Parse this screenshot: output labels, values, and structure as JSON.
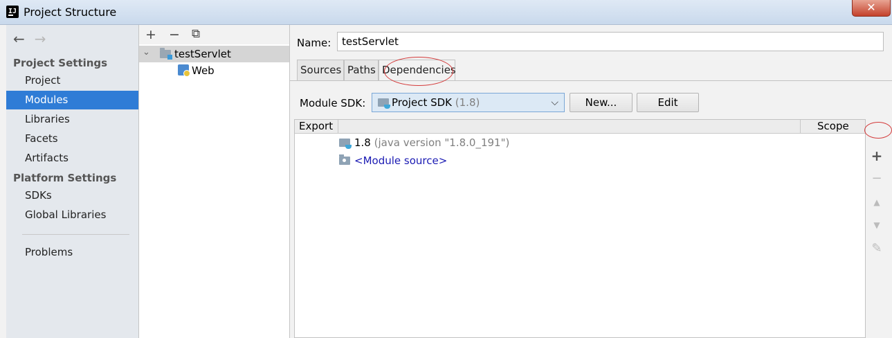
{
  "window": {
    "title": "Project Structure",
    "close_glyph": "✕",
    "app_icon_label": "IJ"
  },
  "nav": {
    "back_glyph": "←",
    "forward_glyph": "→",
    "project_settings_header": "Project Settings",
    "platform_settings_header": "Platform Settings",
    "items": {
      "project": "Project",
      "modules": "Modules",
      "libraries": "Libraries",
      "facets": "Facets",
      "artifacts": "Artifacts",
      "sdks": "SDKs",
      "global_libraries": "Global Libraries",
      "problems": "Problems"
    },
    "active_item": "Modules"
  },
  "tree": {
    "add_glyph": "+",
    "remove_glyph": "−",
    "copy_glyph": "⧉",
    "expand_glyph": "⌄",
    "module_name": "testServlet",
    "child_name": "Web"
  },
  "main": {
    "name_label": "Name:",
    "name_value": "testServlet",
    "tabs": {
      "sources": "Sources",
      "paths": "Paths",
      "dependencies": "Dependencies"
    },
    "active_tab": "Dependencies",
    "module_sdk_label": "Module SDK:",
    "sdk_selected": "Project SDK",
    "sdk_version": "(1.8)",
    "sdk_chevron": "⌵",
    "new_button": "New...",
    "edit_button": "Edit",
    "table": {
      "col_export": "Export",
      "col_scope": "Scope",
      "rows": [
        {
          "name": "1.8",
          "detail": "(java version \"1.8.0_191\")"
        },
        {
          "name": "<Module source>"
        }
      ]
    },
    "side_tools": {
      "add": "+",
      "remove": "−",
      "up": "▲",
      "down": "▼",
      "edit": "✎"
    }
  },
  "colors": {
    "selection_blue": "#2f7cd6",
    "annotation_red": "#d43a3a",
    "link_blue": "#1a1ab3"
  },
  "icons": [
    "app-icon",
    "back-arrow-icon",
    "forward-arrow-icon",
    "add-icon",
    "remove-icon",
    "copy-icon",
    "folder-icon",
    "web-facet-icon",
    "sdk-icon",
    "module-source-icon",
    "move-up-icon",
    "move-down-icon",
    "edit-icon"
  ]
}
